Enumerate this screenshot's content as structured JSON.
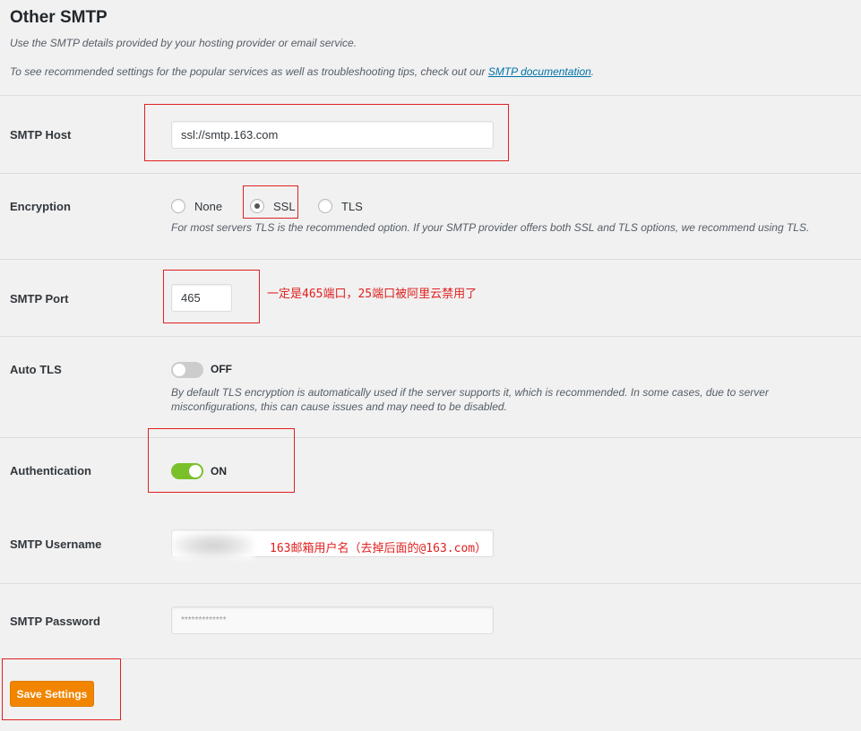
{
  "section": {
    "title": "Other SMTP",
    "desc1": "Use the SMTP details provided by your hosting provider or email service.",
    "desc2_prefix": "To see recommended settings for the popular services as well as troubleshooting tips, check out our ",
    "desc2_link": "SMTP documentation",
    "desc2_suffix": "."
  },
  "smtp_host": {
    "label": "SMTP Host",
    "value": "ssl://smtp.163.com"
  },
  "encryption": {
    "label": "Encryption",
    "options": [
      "None",
      "SSL",
      "TLS"
    ],
    "selected": "SSL",
    "hint": "For most servers TLS is the recommended option. If your SMTP provider offers both SSL and TLS options, we recommend using TLS."
  },
  "smtp_port": {
    "label": "SMTP Port",
    "value": "465",
    "annotation": "一定是465端口，25端口被阿里云禁用了"
  },
  "auto_tls": {
    "label": "Auto TLS",
    "state": "OFF",
    "hint_line1": "By default TLS encryption is automatically used if the server supports it, which is recommended. In some cases, due to server",
    "hint_line2": "misconfigurations, this can cause issues and may need to be disabled."
  },
  "authentication": {
    "label": "Authentication",
    "state": "ON"
  },
  "smtp_username": {
    "label": "SMTP Username",
    "annotation": "163邮箱用户名（去掉后面的@163.com）"
  },
  "smtp_password": {
    "label": "SMTP Password",
    "value": "*************"
  },
  "save_button": {
    "label": "Save Settings"
  },
  "colors": {
    "accent_orange": "#f18500",
    "toggle_on": "#7ac02b",
    "annotation_red": "#e02020",
    "link_blue": "#0073aa"
  }
}
